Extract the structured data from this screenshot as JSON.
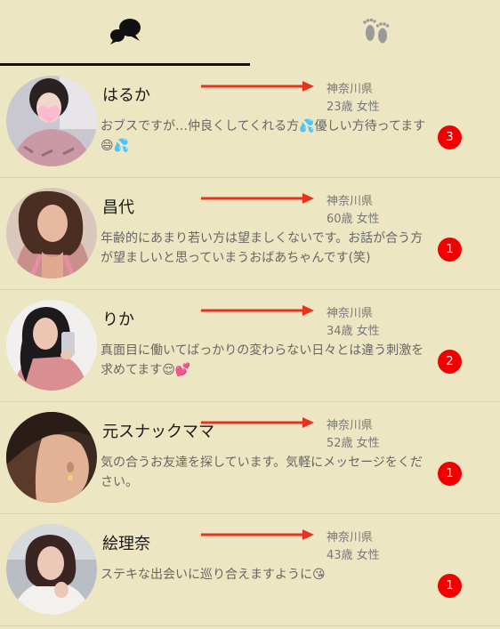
{
  "tabs": [
    {
      "icon": "chat-bubbles-icon",
      "active": true
    },
    {
      "icon": "footprints-icon",
      "active": false
    }
  ],
  "colors": {
    "background": "#ede6c3",
    "arrow": "#e8321e",
    "badge": "#f00000",
    "underline": "#111111"
  },
  "conversations": [
    {
      "name": "はるか",
      "prefecture": "神奈川県",
      "age_sex": "23歳 女性",
      "message": "おブスですが…仲良くしてくれる方💦優しい方待ってます😄💦",
      "unread": "3"
    },
    {
      "name": "昌代",
      "prefecture": "神奈川県",
      "age_sex": "60歳 女性",
      "message": "年齢的にあまり若い方は望ましくないです。お話が合う方が望ましいと思っていまうおばあちゃんです(笑)",
      "unread": "1"
    },
    {
      "name": "りか",
      "prefecture": "神奈川県",
      "age_sex": "34歳 女性",
      "message": "真面目に働いてばっかりの変わらない日々とは違う刺激を求めてます😌💕",
      "unread": "2"
    },
    {
      "name": "元スナックママ",
      "prefecture": "神奈川県",
      "age_sex": "52歳 女性",
      "message": "気の合うお友達を探しています。気軽にメッセージをください。",
      "unread": "1"
    },
    {
      "name": "絵理奈",
      "prefecture": "神奈川県",
      "age_sex": "43歳 女性",
      "message": "ステキな出会いに巡り合えますように😘",
      "unread": "1"
    }
  ]
}
